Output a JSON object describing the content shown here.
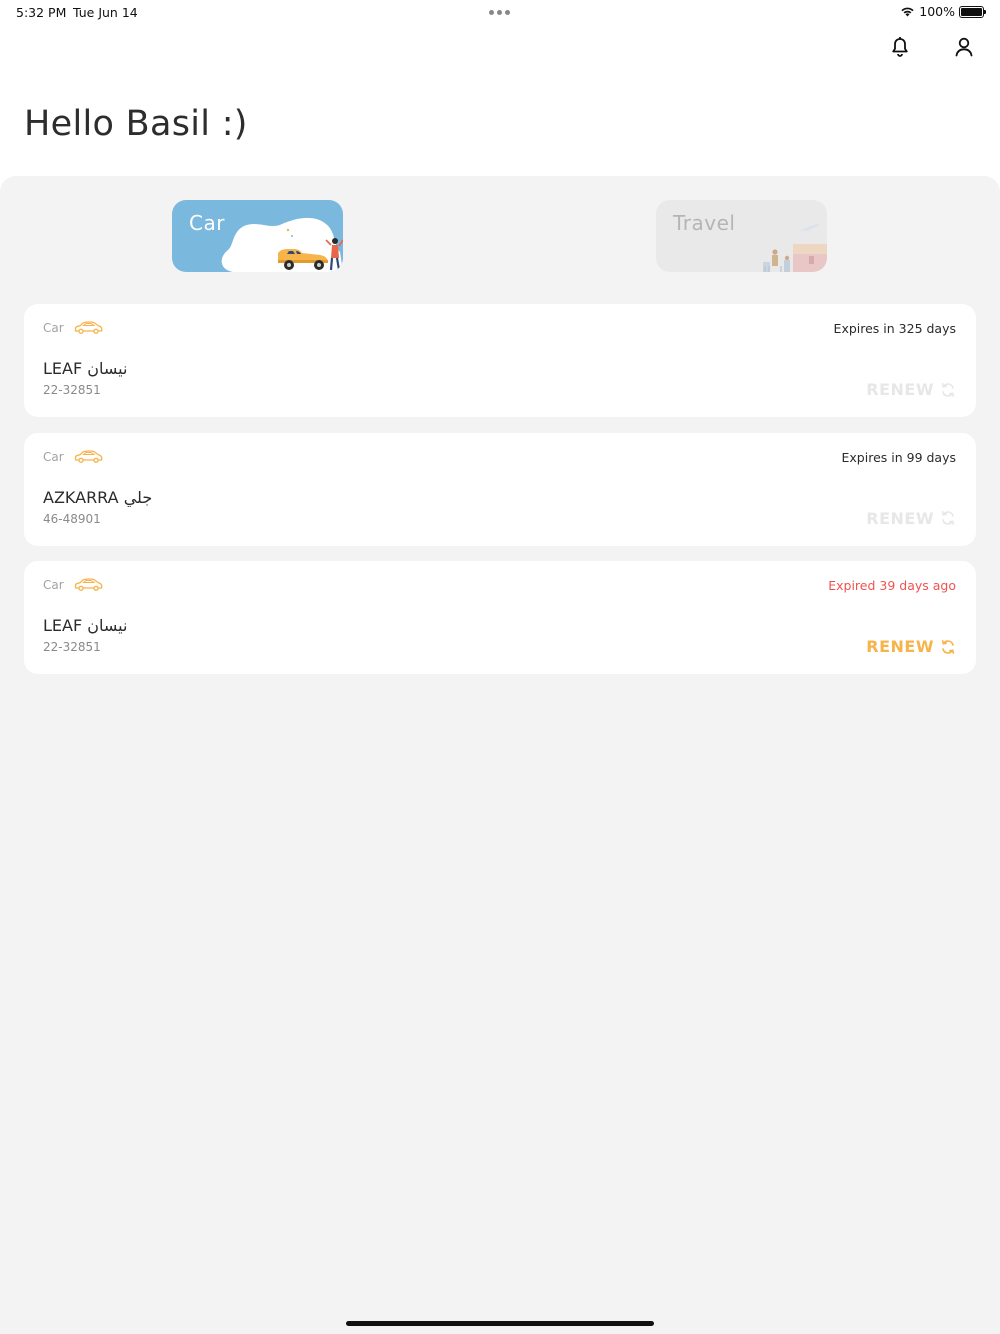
{
  "status_bar": {
    "time": "5:32 PM",
    "date": "Tue Jun 14",
    "battery_text": "100%",
    "battery_level": 1.0
  },
  "header": {
    "icons": [
      "bell-icon",
      "user-icon"
    ]
  },
  "greeting": "Hello Basil :)",
  "categories": [
    {
      "label": "Car",
      "selected": true,
      "color": "#7ab8de"
    },
    {
      "label": "Travel",
      "selected": false,
      "color": "#e9e9e9"
    }
  ],
  "policies": [
    {
      "type": "Car",
      "icon": "car-icon",
      "expiry": "Expires in 325 days",
      "expired": false,
      "vehicle": "LEAF نيسان",
      "plate": "22-32851",
      "renew_label": "RENEW",
      "renew_enabled": false
    },
    {
      "type": "Car",
      "icon": "car-icon",
      "expiry": "Expires in 99 days",
      "expired": false,
      "vehicle": "AZKARRA جلي",
      "plate": "46-48901",
      "renew_label": "RENEW",
      "renew_enabled": false
    },
    {
      "type": "Car",
      "icon": "car-icon",
      "expiry": "Expired 39 days ago",
      "expired": true,
      "vehicle": "LEAF نيسان",
      "plate": "22-32851",
      "renew_label": "RENEW",
      "renew_enabled": true
    }
  ],
  "colors": {
    "accent": "#f6b44b",
    "expired": "#ef5350",
    "car_category": "#7ab8de",
    "background": "#f3f3f3"
  }
}
